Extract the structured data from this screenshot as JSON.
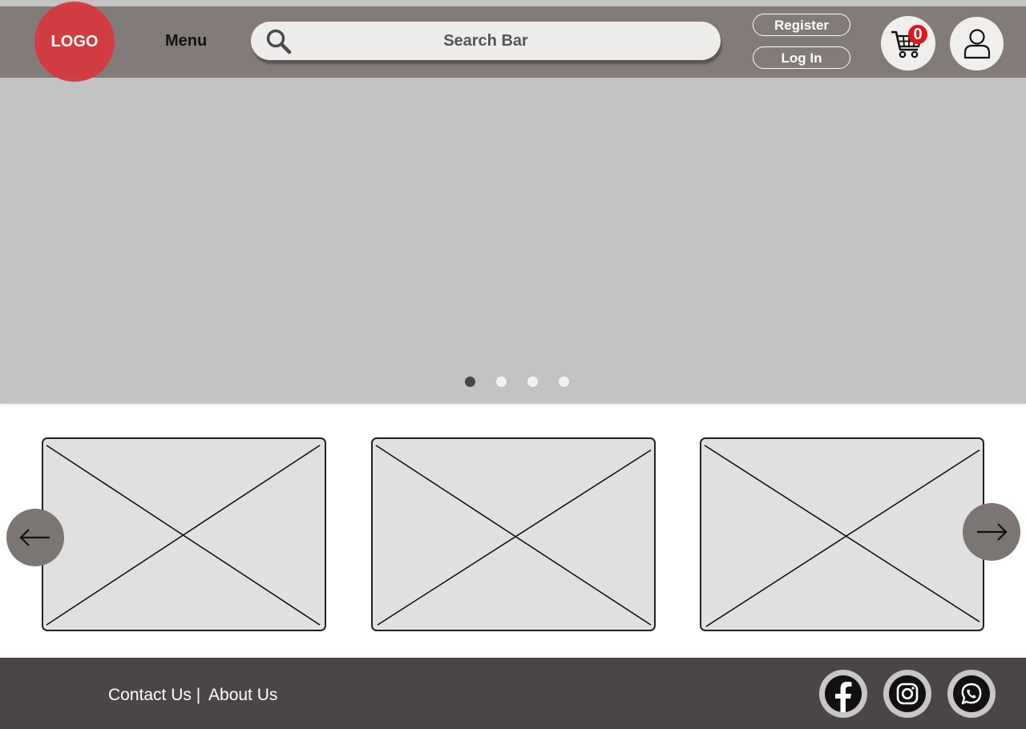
{
  "header": {
    "logo_text": "LOGO",
    "menu_label": "Menu",
    "search_placeholder": "Search Bar",
    "register_label": "Register",
    "login_label": "Log In",
    "cart_count": "0",
    "icons": [
      "search-icon",
      "cart-icon",
      "user-icon"
    ]
  },
  "hero": {
    "slides": 4,
    "active_slide": 1
  },
  "carousel": {
    "cards": 3,
    "prev_icon": "arrow-left-icon",
    "next_icon": "arrow-right-icon"
  },
  "footer": {
    "contact_label": "Contact Us |",
    "about_label": "About Us",
    "social_icons": [
      "facebook-icon",
      "instagram-icon",
      "whatsapp-icon"
    ]
  },
  "colors": {
    "header_bg": "#827b79",
    "logo": "#d43a3d",
    "hero_bg": "#c3c3c3",
    "footer_bg": "#4b4646",
    "badge": "#e3141b"
  }
}
